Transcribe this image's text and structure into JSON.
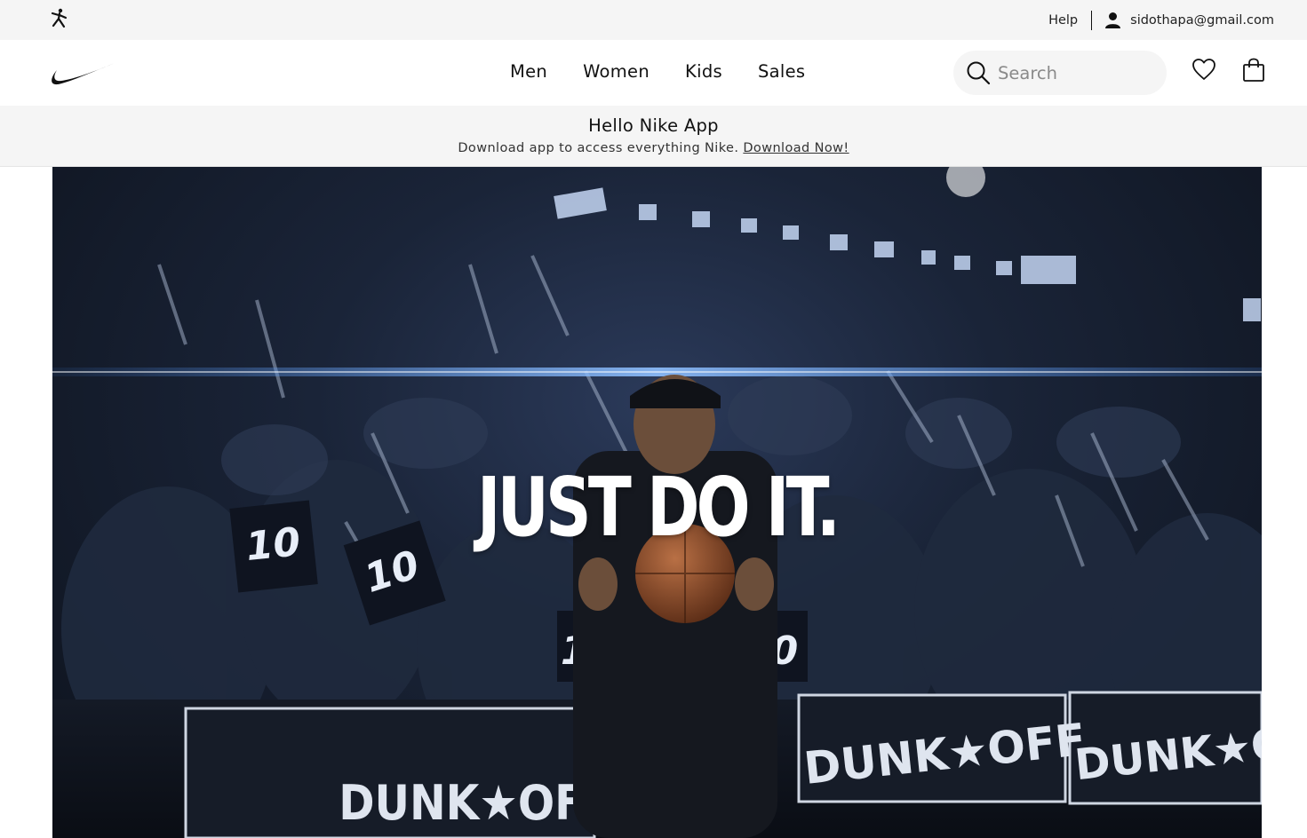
{
  "topbar": {
    "brand_icon": "jordan-jumpman-icon",
    "help_label": "Help",
    "user_icon": "user-icon",
    "user_email": "sidothapa@gmail.com"
  },
  "navbar": {
    "logo_icon": "nike-swoosh-icon",
    "menu": [
      {
        "label": "Men"
      },
      {
        "label": "Women"
      },
      {
        "label": "Kids"
      },
      {
        "label": "Sales"
      }
    ],
    "search": {
      "placeholder": "Search",
      "value": "",
      "icon": "search-icon"
    },
    "favorites_icon": "heart-icon",
    "bag_icon": "shopping-bag-icon"
  },
  "promo": {
    "title": "Hello Nike App",
    "text": "Download app to access everything Nike.",
    "link": "Download Now!"
  },
  "hero": {
    "tagline": "JUST DO IT.",
    "banners": [
      "DUNK★OFF",
      "DUNK★OFF",
      "DUNK★OFF"
    ],
    "jersey_number": "10"
  },
  "colors": {
    "topbar_bg": "#f5f5f5",
    "text": "#111111",
    "hero_bg": "#1a2438"
  }
}
